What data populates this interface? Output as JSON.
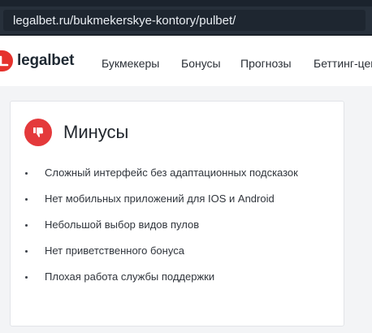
{
  "browser": {
    "url_host": "legalbet",
    "url_rest": ".ru/bukmekerskye-kontory/pulbet/"
  },
  "header": {
    "logo_text": "legalbet",
    "nav": [
      {
        "label": "Букмекеры"
      },
      {
        "label": "Бонусы"
      },
      {
        "label": "Прогнозы"
      },
      {
        "label": "Беттинг-цен"
      }
    ]
  },
  "cons": {
    "title": "Минусы",
    "icon": "thumbs-down-icon",
    "items": [
      "Сложный интерфейс без адаптационных подсказок",
      "Нет мобильных приложений для IOS и Android",
      "Небольшой выбор видов пулов",
      "Нет приветственного бонуса",
      "Плохая работа службы поддержки"
    ]
  },
  "colors": {
    "accent_red": "#e4393b",
    "browser_bar": "#27303b"
  }
}
